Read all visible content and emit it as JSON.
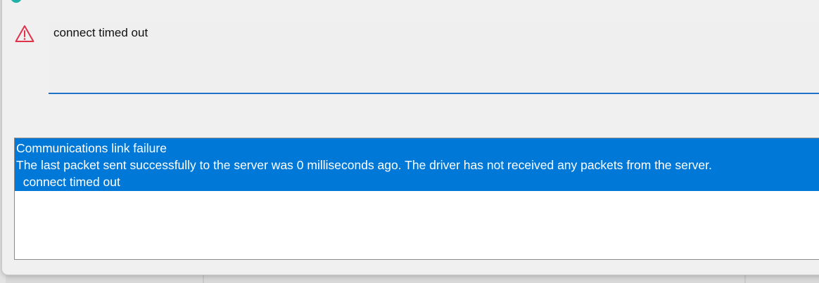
{
  "error_dialog": {
    "message": "connect timed out",
    "details_lines": [
      "Communications link failure",
      "The last packet sent successfully to the server was 0 milliseconds ago. The driver has not received any packets from the server.",
      "  connect timed out"
    ],
    "icon": "warning-icon",
    "colors": {
      "selection": "#0078d7",
      "warning_icon": "#e0334b",
      "focus_underline": "#1e72c8"
    }
  }
}
